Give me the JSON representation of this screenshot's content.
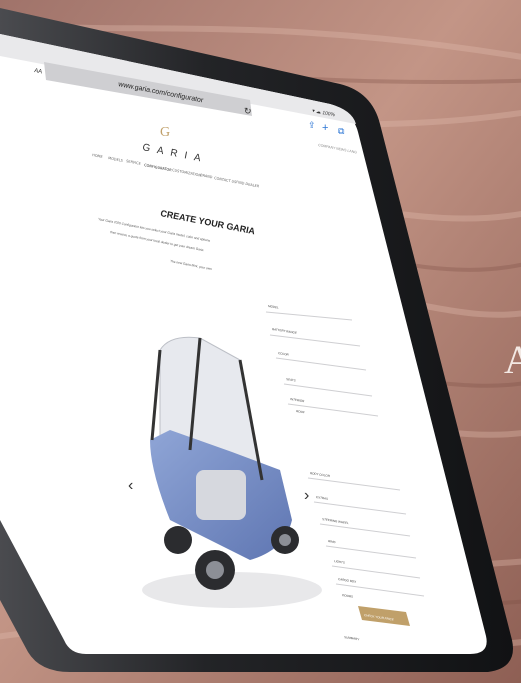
{
  "browser": {
    "url": "www.garia.com/configurator",
    "aa": "AA",
    "status": "▾ ☁ 100%"
  },
  "site": {
    "logo_text": "GARIA",
    "nav": [
      "HOME",
      "MODELS",
      "SERVICE",
      "CONFIGURATOR",
      "CUSTOMIZATION",
      "BRAND",
      "CONTACT US",
      "FIND DEALER"
    ],
    "top_links": "COMPANY  NEWS  LANG"
  },
  "configurator": {
    "title": "CREATE YOUR GARIA",
    "intro_lines": [
      "Your Garia 2020 Configurator lets you select your Garia model, color and options",
      "then receive a quote from your local dealer to get your dream Garia",
      "The new Garia Mini, your own"
    ],
    "form_rows": [
      "MODEL",
      "BATTERY RANGE",
      "COLOR",
      "SEATS",
      "INTERIOR",
      "ROOF",
      "BODY COLOR",
      "EXTRAS",
      "STEERING WHEEL",
      "RIMS",
      "LIGHTS",
      "CARGO BOX",
      "DOORS",
      "SUMMARY"
    ],
    "cta_label": "CHECK YOUR PRICE",
    "prev_arrow": "‹",
    "next_arrow": "›"
  },
  "side_letter": "A",
  "colors": {
    "accent": "#c0a06a",
    "bezel": "#1c1d1f",
    "desert": "#b8877a"
  }
}
